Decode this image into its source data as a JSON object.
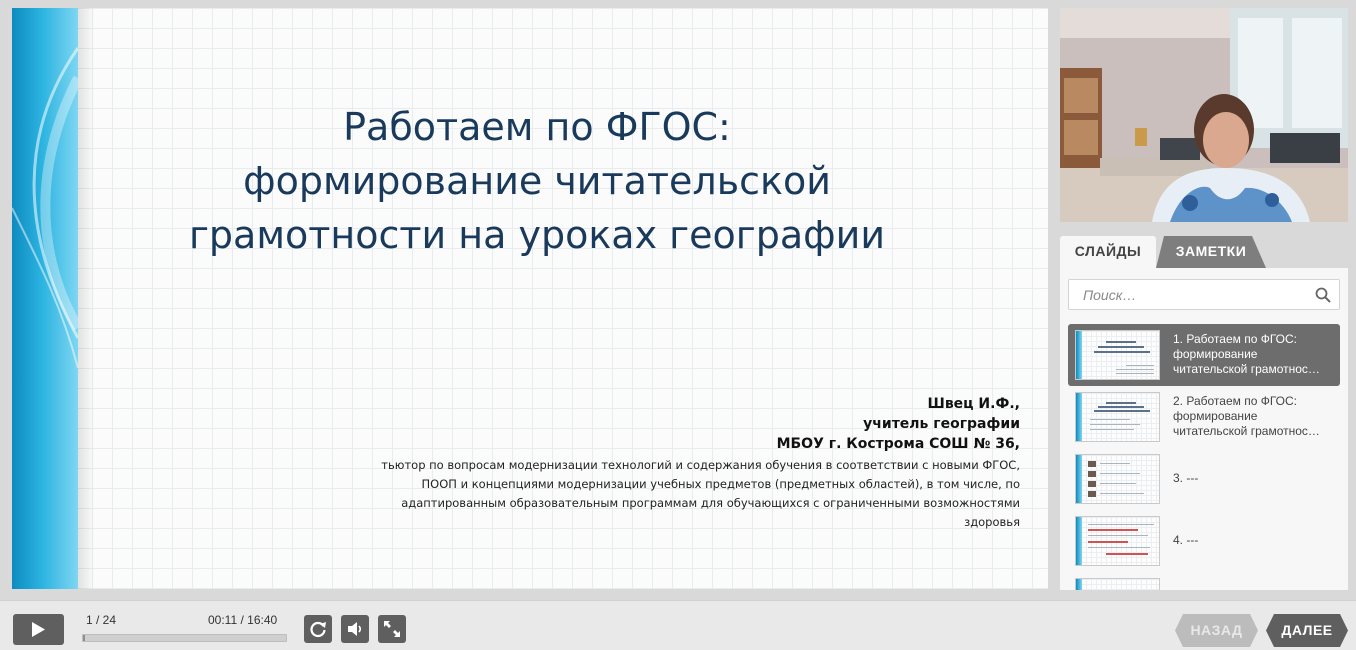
{
  "slide": {
    "title_lines": [
      "Работаем по ФГОС:",
      "формирование читательской",
      "грамотности на уроках географии"
    ],
    "author_lines": [
      "Швец И.Ф.,",
      "учитель географии",
      "МБОУ г. Кострома СОШ № 36,"
    ],
    "author_note": "тьютор по вопросам модернизации технологий и содержания обучения в соответствии с новыми ФГОС, ПООП и концепциями модернизации учебных предметов (предметных областей), в том числе, по адаптированным образовательным программам для обучающихся с ограниченными возможностями здоровья"
  },
  "sidebar": {
    "tabs": [
      {
        "label": "СЛАЙДЫ",
        "active": true
      },
      {
        "label": "ЗАМЕТКИ",
        "active": false
      }
    ],
    "search_placeholder": "Поиск…",
    "items": [
      {
        "lines": [
          "1. Работаем по ФГОС:",
          "формирование",
          "читательской грамотнос…"
        ],
        "active": true
      },
      {
        "lines": [
          "2. Работаем по ФГОС:",
          "формирование",
          "читательской грамотнос…"
        ],
        "active": false
      },
      {
        "lines": [
          "3. ---"
        ],
        "active": false
      },
      {
        "lines": [
          "4. ---"
        ],
        "active": false
      }
    ]
  },
  "player": {
    "counter": "1 / 24",
    "time": "00:11 / 16:40",
    "progress": 0.011,
    "back_label": "НАЗАД",
    "next_label": "ДАЛЕЕ"
  },
  "colors": {
    "title": "#1a3a5c",
    "accent_blue": "#2bb3e0",
    "button_dark": "#5f5f5f",
    "button_disabled": "#bcbcbc"
  },
  "icons": [
    "play-icon",
    "replay-icon",
    "volume-icon",
    "fullscreen-icon",
    "search-icon"
  ]
}
